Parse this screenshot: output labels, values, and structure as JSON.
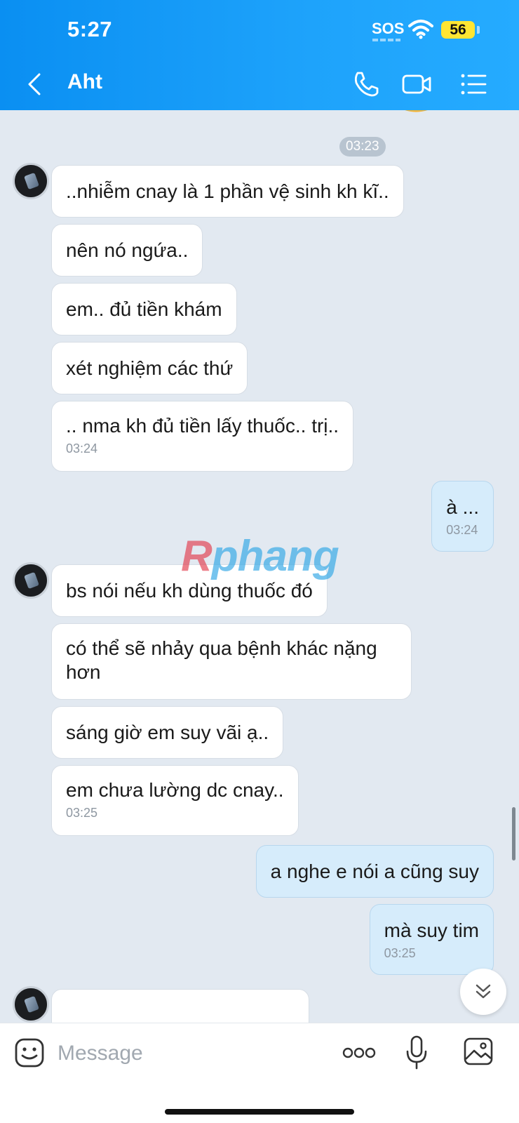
{
  "status_bar": {
    "time": "5:27",
    "sos": "SOS",
    "battery": "56"
  },
  "header": {
    "title": "Aht"
  },
  "watermark": {
    "r": "R",
    "rest": "phang"
  },
  "chat": {
    "time_divider": "03:23",
    "messages": [
      {
        "text": "..nhiễm cnay là 1 phần vệ sinh kh kĩ..",
        "time": ""
      },
      {
        "text": "nên nó ngứa..",
        "time": ""
      },
      {
        "text": "em.. đủ tiền khám",
        "time": ""
      },
      {
        "text": "xét nghiệm các thứ",
        "time": ""
      },
      {
        "text": ".. nma kh đủ tiền lấy thuốc.. trị..",
        "time": "03:24"
      },
      {
        "text": "à ...",
        "time": "03:24"
      },
      {
        "text": "bs nói nếu kh dùng thuốc đó",
        "time": ""
      },
      {
        "text": "có thể sẽ nhảy qua bệnh khác nặng hơn",
        "time": ""
      },
      {
        "text": "sáng giờ em suy vãi ạ..",
        "time": ""
      },
      {
        "text": "em chưa lường dc cnay..",
        "time": "03:25"
      },
      {
        "text": "a nghe e nói a cũng suy",
        "time": ""
      },
      {
        "text": "mà suy tim",
        "time": "03:25"
      }
    ]
  },
  "input": {
    "placeholder": "Message"
  },
  "colors": {
    "header": "#1ea3fb",
    "incoming_bubble": "#ffffff",
    "outgoing_bubble": "#d6ecfb",
    "chat_bg": "#e2e9f1"
  },
  "icons": [
    "back-icon",
    "phone-icon",
    "video-call-icon",
    "menu-list-icon",
    "sticker-icon",
    "more-icon",
    "microphone-icon",
    "image-icon",
    "scroll-down-icon"
  ]
}
